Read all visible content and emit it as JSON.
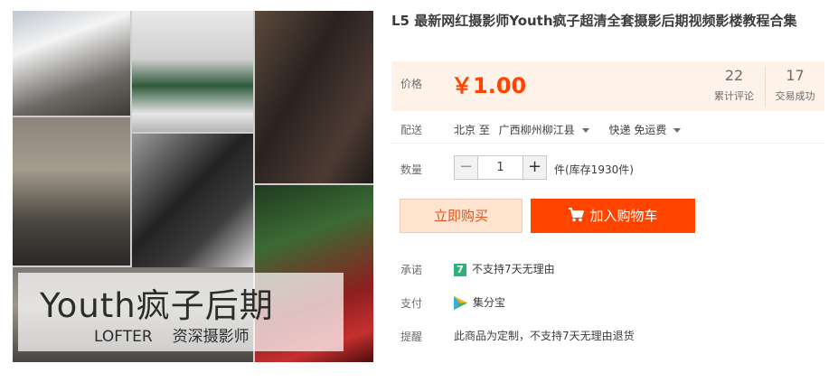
{
  "gallery": {
    "banner_title": "Youth疯子后期",
    "banner_brand": "LOFTER",
    "banner_tagline": "资深摄影师"
  },
  "product": {
    "title": "L5 最新网红摄影师Youth疯子超清全套摄影后期视频影楼教程合集"
  },
  "price": {
    "label": "价格",
    "value": "￥1.00",
    "reviews_count": "22",
    "reviews_label": "累计评论",
    "sales_count": "17",
    "sales_label": "交易成功"
  },
  "delivery": {
    "label": "配送",
    "origin": "北京 至",
    "destination": "广西柳州柳江县",
    "shipping": "快递 免运费"
  },
  "quantity": {
    "label": "数量",
    "minus": "−",
    "value": "1",
    "plus": "+",
    "stock": "件(库存1930件)"
  },
  "actions": {
    "buy_now": "立即购买",
    "add_to_cart": "加入购物车"
  },
  "services": {
    "promise_label": "承诺",
    "promise_badge": "7",
    "promise_text": "不支持7天无理由",
    "payment_label": "支付",
    "payment_text": "集分宝",
    "reminder_label": "提醒",
    "reminder_text": "此商品为定制，不支持7天无理由退货"
  },
  "colors": {
    "accent": "#ff4400",
    "price_panel_bg": "#fff2e8",
    "buy_now_bg": "#ffe4d0",
    "promise_badge": "#2fb27a"
  },
  "icons": [
    "shopping-cart-icon",
    "chevron-down-icon",
    "seven-day-badge-icon",
    "jifenbao-icon"
  ]
}
